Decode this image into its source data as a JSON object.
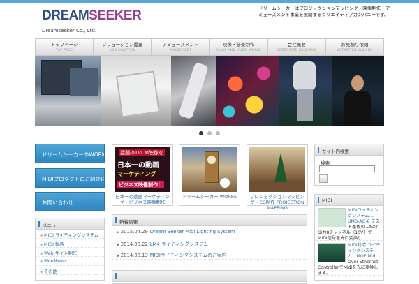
{
  "header": {
    "logo_part1": "DREAM",
    "logo_part2": "SEEKER",
    "company": "Dreamseeker Co., Ltd.",
    "description": "ドリームシーカーはプロジェクションマッピング・映像制作・アミューズメント事業を展開するクリエイティブカンパニーです。"
  },
  "nav": [
    {
      "label": "トップページ",
      "sub": "TOP PAGE"
    },
    {
      "label": "ソリューション提案",
      "sub": "ADD SOLUTION"
    },
    {
      "label": "アミューズメント",
      "sub": "AMUSEMENT"
    },
    {
      "label": "映像・音楽制作",
      "sub": "IMAGE AND MUSIC WORKS"
    },
    {
      "label": "会社概要",
      "sub": "CORPORATE GUIDANCE"
    },
    {
      "label": "お見積り依頼",
      "sub": "ESTIMATED INQUIRY"
    }
  ],
  "slider": {
    "dot_count": 3,
    "active_index": 0
  },
  "left_buttons": [
    {
      "label": "ドリームシーカーのWORKS"
    },
    {
      "label": "MIDIプロダクトのご紹介はこちら"
    },
    {
      "label": "お問い合わせ"
    }
  ],
  "left_menu": {
    "title": "メニュー",
    "items": [
      "MIDI ライティングシステム",
      "MIDI 製品",
      "Web サイト制作",
      "WordPress",
      "その他"
    ]
  },
  "features": [
    {
      "caption": "日本一の動画マーケティング・ビジネス映像制作",
      "img_line1": "話題のTVCM映像を",
      "img_line2": "日本一の動画",
      "img_line3": "マーケティング",
      "img_line4": "ビジネス映像制作！"
    },
    {
      "caption": "ドリームシーカー WORKS"
    },
    {
      "caption": "プロジェクションマッピング・CG制作 PROJECTION MAPPING"
    }
  ],
  "news": {
    "title": "新着情報",
    "items": [
      {
        "date": "2015.04.29",
        "title": "Dream Seeker Midi Lighting System"
      },
      {
        "date": "2014.08.22",
        "title": "LM4 ライティングシステム"
      },
      {
        "date": "2014.08.13",
        "title": "MIDIライティングシステムのご案内"
      }
    ]
  },
  "search": {
    "title": "サイト内検索",
    "label": "検索:",
    "placeholder": ""
  },
  "midi": {
    "title": "MIDI",
    "items": [
      {
        "link": "MIDIライティングシステム…UMB-AO-8",
        "text": "テスト基板のご紹介 出力8チャンネル（10V）でMIDI信号を光に変換し…"
      },
      {
        "link": "MIDI対応 ライティングシステム…MOE Midi",
        "text": "Over Ethernet ControllerでMidiを光に変換します。"
      }
    ]
  },
  "bottom_box": {
    "title": ""
  }
}
